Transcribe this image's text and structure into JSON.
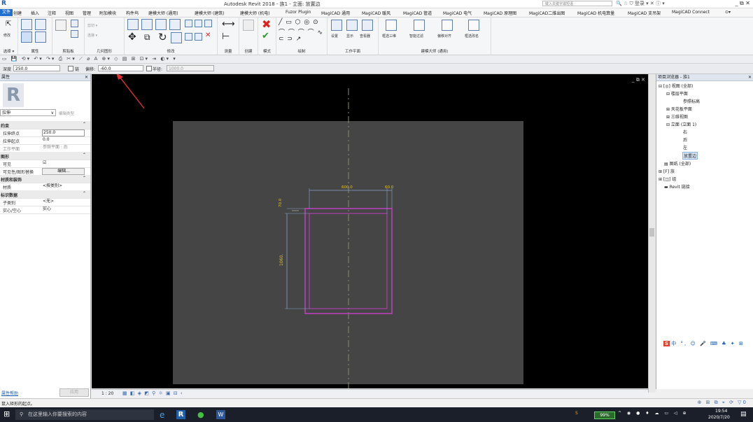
{
  "titlebar": {
    "logo": "R",
    "title": "Autodesk Revit 2018 -    族1 - 立面: 放置边",
    "search_placeholder": "键入关键字或短语",
    "signin": "登录",
    "window_controls": "_ ⧉ ✕"
  },
  "menu": {
    "tabs": [
      "文件",
      "创建",
      "插入",
      "注释",
      "视图",
      "管理",
      "附加模块",
      "构件坞",
      "建模大师 (通用)",
      "建模大师 (建筑)",
      "建模大师 (机电)",
      "Fuzor Plugin",
      "MagiCAD 通用",
      "MagiCAD 暖风",
      "MagiCAD 管道",
      "MagiCAD 电气",
      "MagiCAD 原理图",
      "MagiCAD二维出图",
      "MagiCAD 机电算量",
      "MagiCAD 支吊架",
      "MagiCAD Connect"
    ],
    "active_index": 0
  },
  "ribbon": {
    "groups": [
      "选择 ▾",
      "属性",
      "剪贴板",
      "几何图形",
      "修改",
      "测量",
      "创建",
      "模式",
      "绘制",
      "工作平面",
      "建模大师 (通用)"
    ],
    "labels": {
      "modify": "修改",
      "settings": "设置",
      "show": "显示",
      "viewer": "查看器",
      "align3d": "框选三维",
      "smart_filter": "智能过滤",
      "offset_align": "偏移对齐",
      "rename": "框选改名",
      "cut": "剪切 ▾",
      "join": "连接 ▾"
    },
    "finish_symbol": "✔",
    "cancel_symbol": "✖"
  },
  "options": {
    "depth_label": "深度",
    "depth_value": "250.0",
    "chain_label": "链",
    "offset_label": "偏移:",
    "offset_value": "-60.0",
    "radius_label": "半径:",
    "radius_value": "1000.0"
  },
  "properties": {
    "title": "属性",
    "type_selector": "拉伸",
    "edit_type": "编辑类型",
    "rows": [
      {
        "k": "约束",
        "section": true
      },
      {
        "k": "拉伸终点",
        "v": "250.0",
        "box": true
      },
      {
        "k": "拉伸起点",
        "v": "0.0"
      },
      {
        "k": "工作平面",
        "v": "参照平面 : 后"
      },
      {
        "k": "图形",
        "section": true
      },
      {
        "k": "可见",
        "v": "☑"
      },
      {
        "k": "可见性/图形替换",
        "v": "编辑...",
        "btn": true
      },
      {
        "k": "材质和装饰",
        "section": true
      },
      {
        "k": "材质",
        "v": "<按类别>"
      },
      {
        "k": "标识数据",
        "section": true
      },
      {
        "k": "子类别",
        "v": "<无>"
      },
      {
        "k": "实心/空心",
        "v": "实心"
      }
    ],
    "help_link": "属性帮助",
    "apply": "应用"
  },
  "drawing": {
    "dim_top_1": "600.0",
    "dim_top_2": "60.0",
    "dim_left_small": "70.0",
    "dim_left_big": "1060."
  },
  "browser": {
    "title": "项目浏览器 - 族1",
    "nodes": [
      {
        "t": "⊟ [◎] 视图 (全部)",
        "lvl": 0
      },
      {
        "t": "⊟ 楼层平面",
        "lvl": 1
      },
      {
        "t": "参照标高",
        "lvl": 3
      },
      {
        "t": "⊞ 天花板平面",
        "lvl": 1
      },
      {
        "t": "⊞ 三维视图",
        "lvl": 1
      },
      {
        "t": "⊟ 立面 (立面 1)",
        "lvl": 1
      },
      {
        "t": "右",
        "lvl": 3
      },
      {
        "t": "后",
        "lvl": 3
      },
      {
        "t": "左",
        "lvl": 3
      },
      {
        "t": "放置边",
        "lvl": 3,
        "sel": true
      },
      {
        "t": "▤ 图纸 (全部)",
        "lvl": 0
      },
      {
        "t": "⊞ [F] 族",
        "lvl": 0
      },
      {
        "t": "⊞ [◫] 组",
        "lvl": 0
      },
      {
        "t": "▬ Revit 链接",
        "lvl": 0
      }
    ]
  },
  "viewbar": {
    "scale": "1 : 20"
  },
  "status": {
    "text": "鼠入矩形的起点。"
  },
  "taskbar": {
    "search_placeholder": "在这里输入你要搜索的内容",
    "battery": "99%",
    "time": "19:54",
    "date": "2020/7/20"
  },
  "colors": {
    "canvas_bg": "#000000",
    "view_bg": "#454545",
    "sketch": "#c040c0",
    "dimension": "#8aa0c8",
    "dim_text": "#e6c21a",
    "arrow": "#e03030"
  }
}
